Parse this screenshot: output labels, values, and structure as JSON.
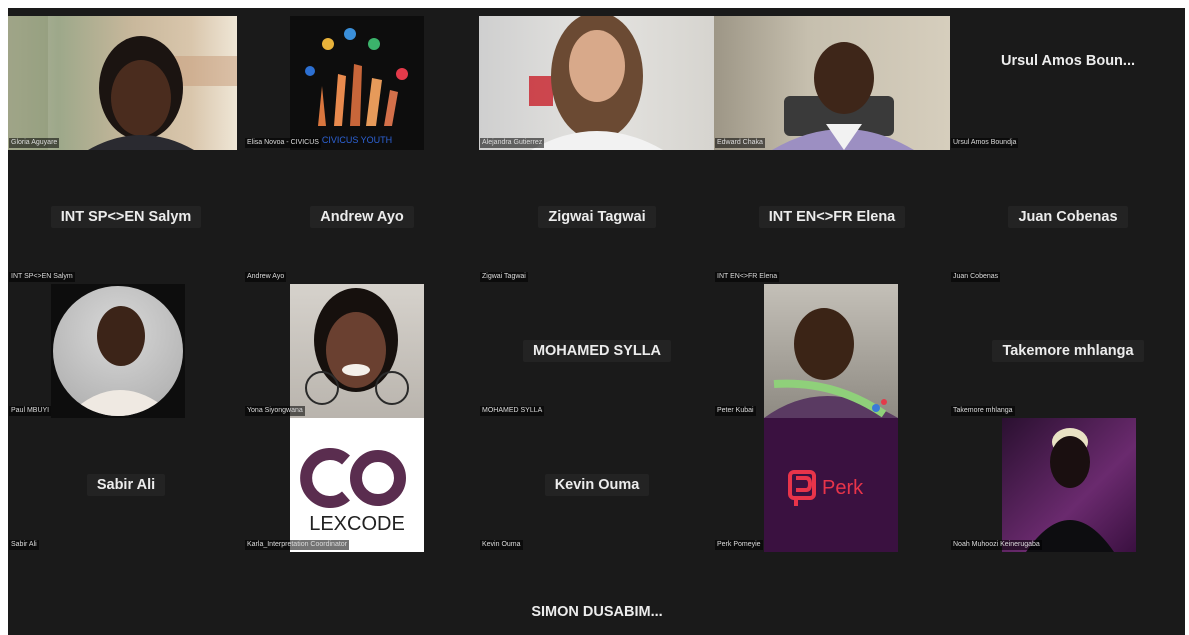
{
  "meeting": {
    "participants": [
      {
        "id": "p1",
        "tile_name": "",
        "label": "Gloria Aguyare"
      },
      {
        "id": "p2",
        "tile_name": "",
        "label": "Elisa Novoa - CIVICUS",
        "logo_text": "CIVICUS YOUTH"
      },
      {
        "id": "p3",
        "tile_name": "",
        "label": "Alejandra Gutierrez"
      },
      {
        "id": "p4",
        "tile_name": "",
        "label": "Edward Chaka"
      },
      {
        "id": "p5",
        "tile_name": "Ursul  Amos  Boun...",
        "label": "Ursul Amos Boundja"
      },
      {
        "id": "p6",
        "tile_name": "INT SP<>EN Salym",
        "label": "INT SP<>EN Salym"
      },
      {
        "id": "p7",
        "tile_name": "Andrew Ayo",
        "label": "Andrew Ayo"
      },
      {
        "id": "p8",
        "tile_name": "Zigwai Tagwai",
        "label": "Zigwai Tagwai"
      },
      {
        "id": "p9",
        "tile_name": "INT EN<>FR Elena",
        "label": "INT EN<>FR Elena"
      },
      {
        "id": "p10",
        "tile_name": "Juan Cobenas",
        "label": "Juan Cobenas"
      },
      {
        "id": "p11",
        "tile_name": "",
        "label": "Paul MBUYI"
      },
      {
        "id": "p12",
        "tile_name": "",
        "label": "Yona Siyongwana"
      },
      {
        "id": "p13",
        "tile_name": "MOHAMED SYLLA",
        "label": "MOHAMED SYLLA"
      },
      {
        "id": "p14",
        "tile_name": "",
        "label": "Peter Kubai"
      },
      {
        "id": "p15",
        "tile_name": "Takemore mhlanga",
        "label": "Takemore mhlanga"
      },
      {
        "id": "p16",
        "tile_name": "Sabir Ali",
        "label": "Sabir Ali"
      },
      {
        "id": "p17",
        "tile_name": "",
        "label": "Karla_Interpretation Coordinator",
        "logo_text": "LEXCODE"
      },
      {
        "id": "p18",
        "tile_name": "Kevin Ouma",
        "label": "Kevin Ouma"
      },
      {
        "id": "p19",
        "tile_name": "",
        "label": "Perk Pomeyie",
        "logo_text": "Perk"
      },
      {
        "id": "p20",
        "tile_name": "",
        "label": "Noah Muhoozi Keinerugaba"
      },
      {
        "id": "p21",
        "tile_name": "SIMON  DUSABIM...",
        "label": ""
      }
    ]
  },
  "colors": {
    "background": "#1a1a1a",
    "name_text": "#ececec",
    "perk_bg": "#3a1140",
    "perk_red": "#e8344a",
    "lexcode_purple": "#5a2d4f"
  }
}
